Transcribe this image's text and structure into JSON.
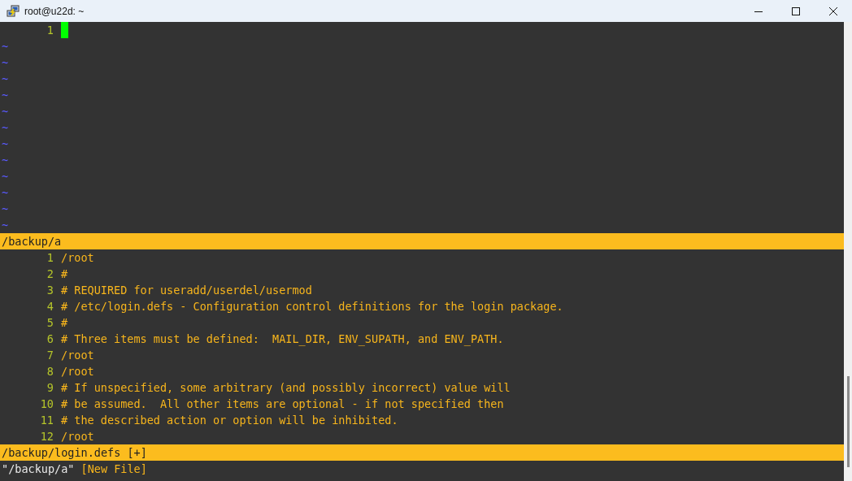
{
  "window": {
    "title": "root@u22d: ~"
  },
  "top_pane": {
    "lines": [
      {
        "number": "1",
        "cursor": true
      }
    ],
    "tildes": [
      "~",
      "~",
      "~",
      "~",
      "~",
      "~",
      "~",
      "~",
      "~",
      "~",
      "~",
      "~"
    ],
    "status": "/backup/a"
  },
  "bottom_pane": {
    "lines": [
      {
        "number": "1",
        "text": "/root"
      },
      {
        "number": "2",
        "text": "#"
      },
      {
        "number": "3",
        "text": "# REQUIRED for useradd/userdel/usermod"
      },
      {
        "number": "4",
        "text": "# /etc/login.defs - Configuration control definitions for the login package."
      },
      {
        "number": "5",
        "text": "#"
      },
      {
        "number": "6",
        "text": "# Three items must be defined:  MAIL_DIR, ENV_SUPATH, and ENV_PATH."
      },
      {
        "number": "7",
        "text": "/root"
      },
      {
        "number": "8",
        "text": "/root"
      },
      {
        "number": "9",
        "text": "# If unspecified, some arbitrary (and possibly incorrect) value will"
      },
      {
        "number": "10",
        "text": "# be assumed.  All other items are optional - if not specified then"
      },
      {
        "number": "11",
        "text": "# the described action or option will be inhibited."
      },
      {
        "number": "12",
        "text": "/root"
      }
    ],
    "status": "/backup/login.defs [+]"
  },
  "command_line": {
    "file": "\"/backup/a\"",
    "note": "[New File]"
  }
}
